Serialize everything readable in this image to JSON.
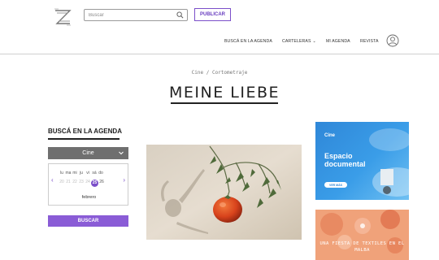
{
  "header": {
    "search_placeholder": "Buscar",
    "publish_label": "PUBLICAR",
    "nav": [
      {
        "label": "BUSCÁ EN LA AGENDA"
      },
      {
        "label": "CARTELERAS"
      },
      {
        "label": "MI AGENDA"
      },
      {
        "label": "REVISTA"
      }
    ]
  },
  "breadcrumb": "Cine / Cortometraje",
  "page_title": "MEINE LIEBE",
  "agenda": {
    "heading": "BUSCÁ EN LA AGENDA",
    "category": "Cine",
    "weekdays": [
      "lu",
      "ma",
      "mi",
      "ju",
      "vi",
      "sá",
      "do"
    ],
    "days": [
      "20",
      "21",
      "22",
      "23",
      "24",
      "25",
      "26"
    ],
    "selected_day": "25",
    "month": "febrero",
    "search_button": "BUSCAR"
  },
  "ads": {
    "ad1": {
      "tag": "Cine",
      "headline": "Espacio documental",
      "button": "VER MÁS"
    },
    "ad2": {
      "text": "UNA FIESTA DE TEXTILES EN EL MALBA"
    }
  },
  "colors": {
    "accent": "#7b4fc9",
    "ad_blue": "#2f87d8",
    "ad_orange": "#f0a27a"
  }
}
